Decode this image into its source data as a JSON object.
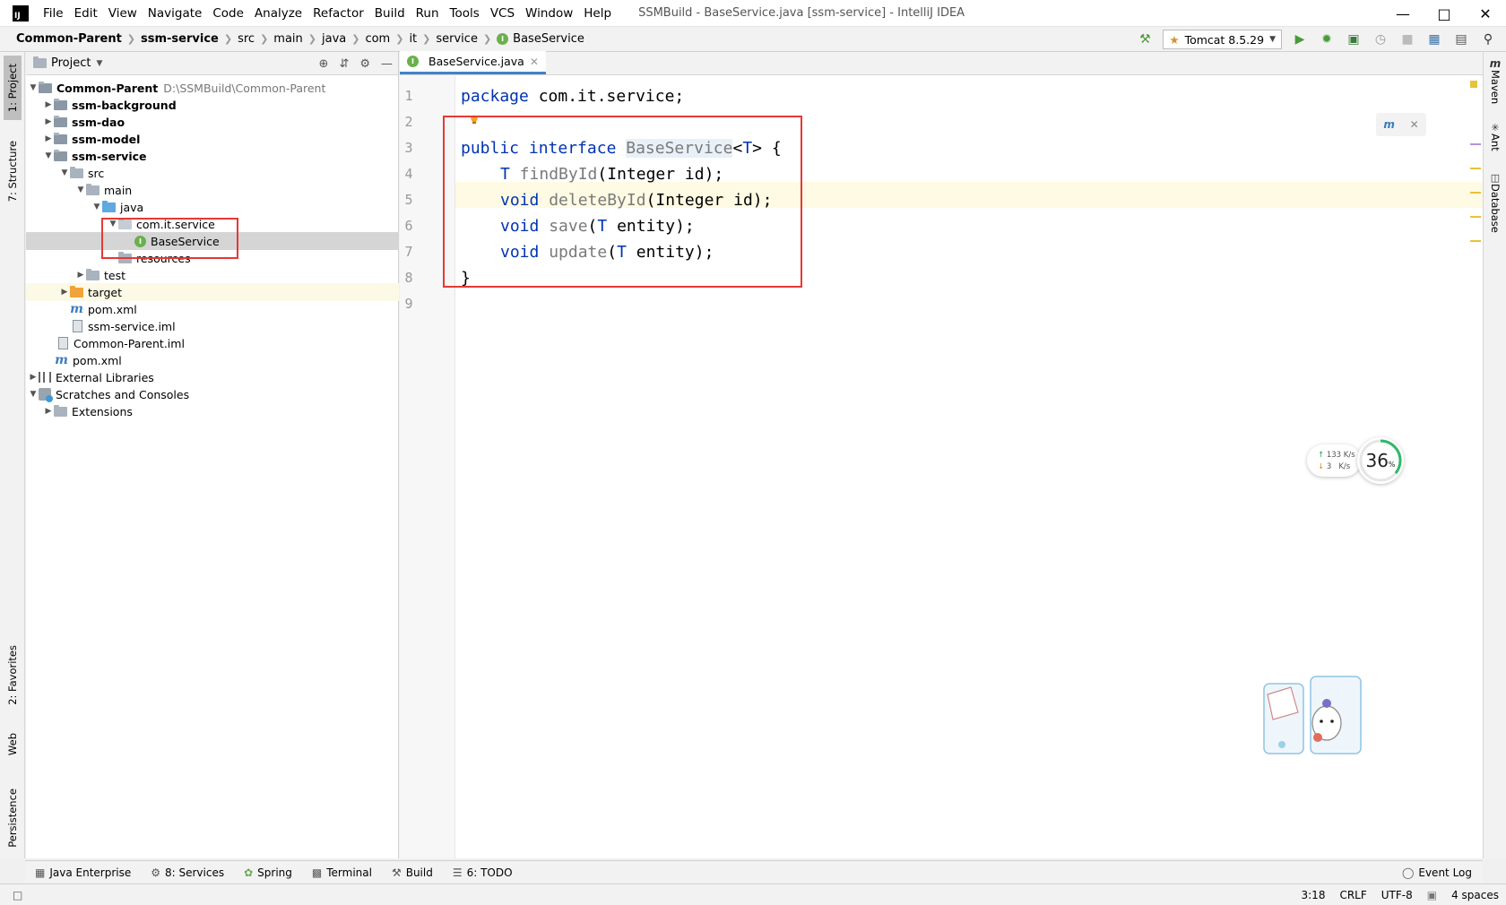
{
  "window": {
    "logo_text": "IJ",
    "title": "SSMBuild - BaseService.java [ssm-service] - IntelliJ IDEA"
  },
  "menu": [
    {
      "label": "File",
      "mnemonic": "F"
    },
    {
      "label": "Edit",
      "mnemonic": "E"
    },
    {
      "label": "View",
      "mnemonic": "V"
    },
    {
      "label": "Navigate",
      "mnemonic": "N"
    },
    {
      "label": "Code",
      "mnemonic": "C"
    },
    {
      "label": "Analyze",
      "mnemonic": "z"
    },
    {
      "label": "Refactor",
      "mnemonic": "R"
    },
    {
      "label": "Build",
      "mnemonic": "B"
    },
    {
      "label": "Run",
      "mnemonic": "u"
    },
    {
      "label": "Tools",
      "mnemonic": "T"
    },
    {
      "label": "VCS",
      "mnemonic": "S"
    },
    {
      "label": "Window",
      "mnemonic": "W"
    },
    {
      "label": "Help",
      "mnemonic": "H"
    }
  ],
  "breadcrumbs": [
    "Common-Parent",
    "ssm-service",
    "src",
    "main",
    "java",
    "com",
    "it",
    "service",
    "BaseService"
  ],
  "run_config": {
    "label": "Tomcat 8.5.29"
  },
  "left_strip": [
    "1: Project",
    "7: Structure",
    "2: Favorites",
    "Web",
    "Persistence"
  ],
  "right_strip": [
    "Maven",
    "Ant",
    "Database"
  ],
  "project_panel": {
    "title": "Project",
    "tree": [
      {
        "label": "Common-Parent",
        "path": "D:\\SSMBuild\\Common-Parent"
      },
      {
        "label": "ssm-background"
      },
      {
        "label": "ssm-dao"
      },
      {
        "label": "ssm-model"
      },
      {
        "label": "ssm-service"
      },
      {
        "label": "src"
      },
      {
        "label": "main"
      },
      {
        "label": "java"
      },
      {
        "label": "com.it.service"
      },
      {
        "label": "BaseService"
      },
      {
        "label": "resources"
      },
      {
        "label": "test"
      },
      {
        "label": "target"
      },
      {
        "label": "pom.xml"
      },
      {
        "label": "ssm-service.iml"
      },
      {
        "label": "Common-Parent.iml"
      },
      {
        "label": "pom.xml"
      },
      {
        "label": "External Libraries"
      },
      {
        "label": "Scratches and Consoles"
      },
      {
        "label": "Extensions"
      }
    ]
  },
  "editor": {
    "tab_label": "BaseService.java",
    "line_numbers": [
      "1",
      "2",
      "3",
      "4",
      "5",
      "6",
      "7",
      "8",
      "9"
    ],
    "code": {
      "l1_kw": "package",
      "l1_rest": " com.it.service;",
      "l3_kw1": "public",
      "l3_kw2": " interface ",
      "l3_name": "BaseService",
      "l3_lt": "<",
      "l3_T": "T",
      "l3_rest": "> {",
      "l4_T": "T",
      "l4_m": " findById",
      "l4_rest": "(Integer id);",
      "l5_kw": "void",
      "l5_m": " deleteById",
      "l5_rest": "(Integer id);",
      "l6_kw": "void",
      "l6_m": " save",
      "l6_p": "(",
      "l6_T": "T",
      "l6_rest": " entity);",
      "l7_kw": "void",
      "l7_m": " update",
      "l7_p": "(",
      "l7_T": "T",
      "l7_rest": " entity);",
      "l8": "}"
    }
  },
  "bottom_tools": [
    {
      "label": "Java Enterprise",
      "icon": "java-enterprise-icon"
    },
    {
      "label": "8: Services",
      "icon": "services-icon"
    },
    {
      "label": "Spring",
      "icon": "spring-icon"
    },
    {
      "label": "Terminal",
      "icon": "terminal-icon"
    },
    {
      "label": "Build",
      "icon": "hammer-icon"
    },
    {
      "label": "6: TODO",
      "icon": "todo-icon"
    }
  ],
  "event_log": "Event Log",
  "status": {
    "position": "3:18",
    "line_sep": "CRLF",
    "encoding": "UTF-8",
    "indent": "4 spaces"
  },
  "net_widget": {
    "up": "133 K/s",
    "down": "3   K/s",
    "percent": "36",
    "percent_unit": "%"
  },
  "colors": {
    "keyword": "#0033b3",
    "highlight_box": "#e53935",
    "accent": "#4083c9"
  }
}
